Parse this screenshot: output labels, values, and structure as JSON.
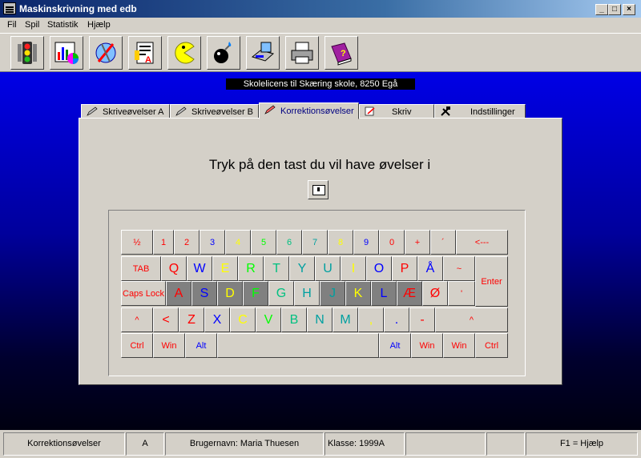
{
  "window": {
    "title": "Maskinskrivning med edb",
    "min": "_",
    "max": "□",
    "close": "×"
  },
  "menu": [
    "Fil",
    "Spil",
    "Statistik",
    "Hjælp"
  ],
  "toolbar": [
    "traffic-light-icon",
    "chart-icon",
    "compass-icon",
    "document-icon",
    "pacman-icon",
    "bomb-icon",
    "scanner-icon",
    "printer-icon",
    "help-book-icon"
  ],
  "license": "Skolelicens til Skæring skole, 8250 Egå",
  "tabs": [
    "Skriveøvelser A",
    "Skriveøvelser B",
    "Korrektionsøvelser",
    "Skriv",
    "Indstillinger"
  ],
  "prompt": "Tryk på den tast du vil have øvelser i",
  "keyboard": {
    "row1": [
      "½",
      "1",
      "2",
      "3",
      "4",
      "5",
      "6",
      "7",
      "8",
      "9",
      "0",
      "+",
      "´",
      "<---"
    ],
    "row2": [
      "TAB",
      "Q",
      "W",
      "E",
      "R",
      "T",
      "Y",
      "U",
      "I",
      "O",
      "P",
      "Å",
      "~",
      "Enter"
    ],
    "row3": [
      "Caps Lock",
      "A",
      "S",
      "D",
      "F",
      "G",
      "H",
      "J",
      "K",
      "L",
      "Æ",
      "Ø",
      "'"
    ],
    "row4": [
      "^",
      "<",
      "Z",
      "X",
      "C",
      "V",
      "B",
      "N",
      "M",
      ",",
      ".",
      "-",
      "^"
    ],
    "row5": [
      "Ctrl",
      "Win",
      "Alt",
      "",
      "Alt",
      "Win",
      "Win",
      "Ctrl"
    ]
  },
  "colors": {
    "red": "#ff0000",
    "blue": "#0000ff",
    "yellow": "#ffff00",
    "green": "#00ff00",
    "teal": "#00c080",
    "cyan": "#00a0a0",
    "darkgreen": "#00a000"
  },
  "status": {
    "exercise": "Korrektionsøvelser",
    "mode": "A",
    "user": "Brugernavn: Maria Thuesen",
    "class": "Klasse: 1999A",
    "help": "F1 = Hjælp"
  }
}
